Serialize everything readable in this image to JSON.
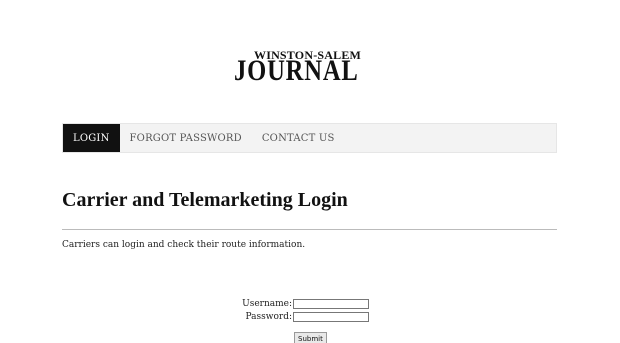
{
  "logo": {
    "top": "WINSTON-SALEM",
    "main": "JOURNAL"
  },
  "nav": {
    "items": [
      {
        "label": "LOGIN",
        "active": true
      },
      {
        "label": "FORGOT PASSWORD",
        "active": false
      },
      {
        "label": "CONTACT US",
        "active": false
      }
    ]
  },
  "main": {
    "title": "Carrier and Telemarketing Login",
    "intro": "Carriers can login and check their route information."
  },
  "form": {
    "username_label": "Username:",
    "password_label": "Password:",
    "username_value": "",
    "password_value": "",
    "submit_label": "Submit"
  },
  "colors": {
    "nav_active_bg": "#111111",
    "nav_bg": "#f3f3f3"
  }
}
